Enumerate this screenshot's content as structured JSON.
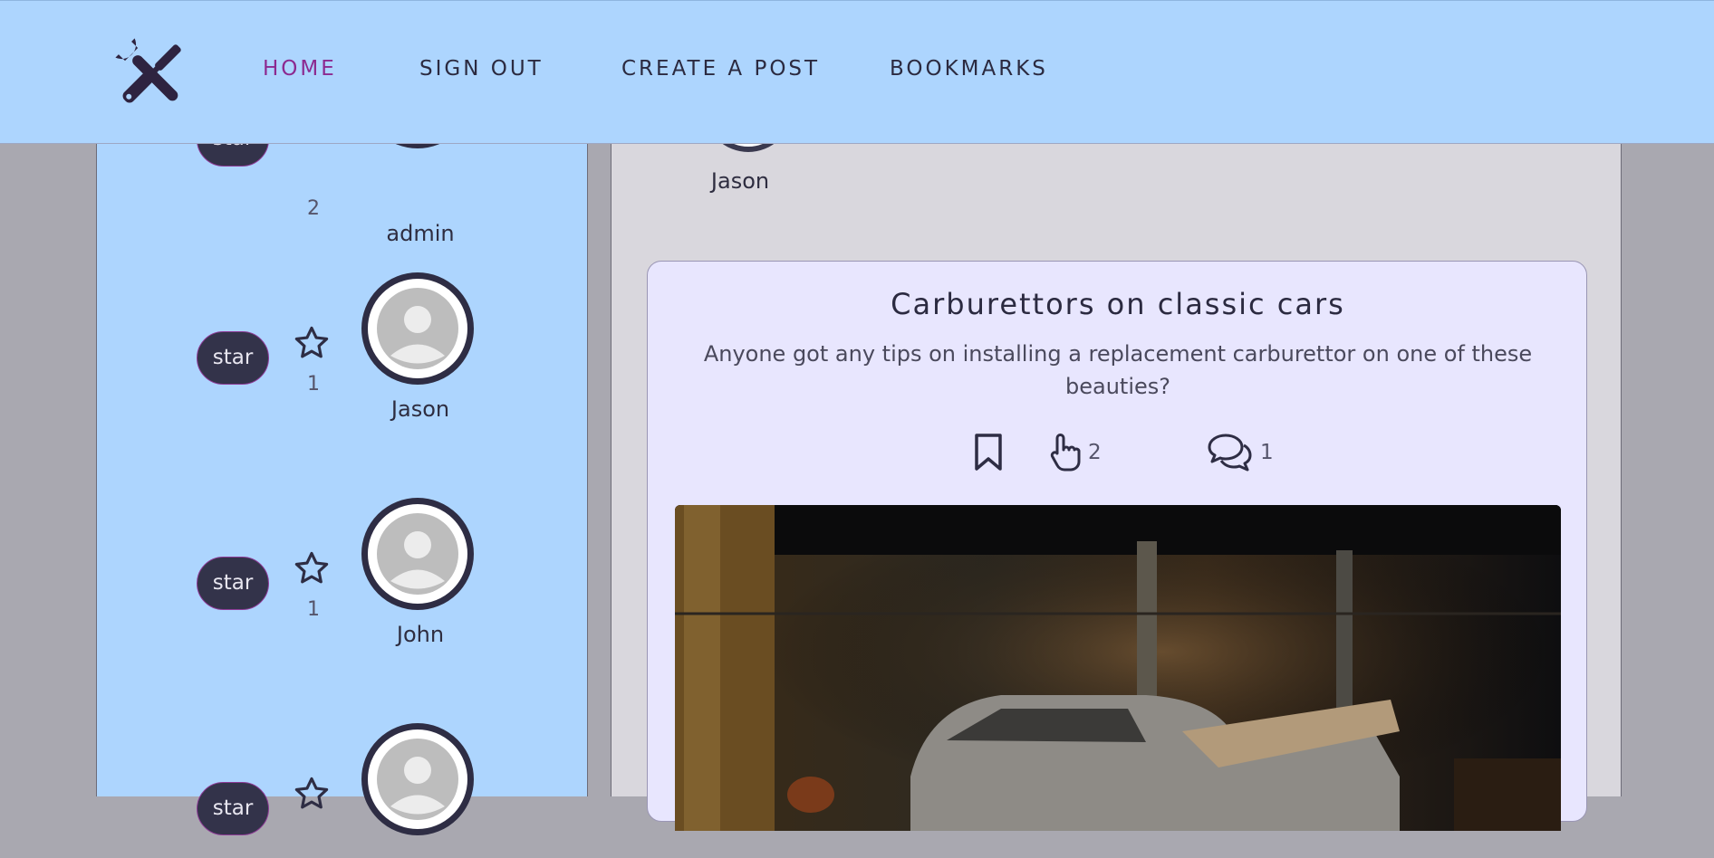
{
  "nav": {
    "logo_icon": "tools-icon",
    "links": [
      {
        "label": "HOME",
        "active": true
      },
      {
        "label": "SIGN OUT",
        "active": false
      },
      {
        "label": "CREATE A POST",
        "active": false
      },
      {
        "label": "BOOKMARKS",
        "active": false
      }
    ]
  },
  "sidebar": {
    "users": [
      {
        "name": "admin",
        "star_label": "star",
        "star_count": "2"
      },
      {
        "name": "Jason",
        "star_label": "star",
        "star_count": "1"
      },
      {
        "name": "John",
        "star_label": "star",
        "star_count": "1"
      },
      {
        "name": "",
        "star_label": "star",
        "star_count": ""
      }
    ]
  },
  "main": {
    "top_author": {
      "name": "Jason"
    },
    "post": {
      "title": "Carburettors on classic cars",
      "body": "Anyone got any tips on installing a replacement carburettor on one of these beauties?",
      "bookmark_icon": "bookmark-icon",
      "like_icon": "pointing-hand-icon",
      "like_count": "2",
      "comment_icon": "comments-icon",
      "comment_count": "1",
      "image_alt": "abandoned car in a dark brick garage"
    }
  },
  "colors": {
    "navbar_bg": "#add5fe",
    "main_bg": "#d9d7dd",
    "card_bg": "#e8e6fe",
    "active_link": "#8c2a90",
    "dark": "#2b2a40"
  }
}
